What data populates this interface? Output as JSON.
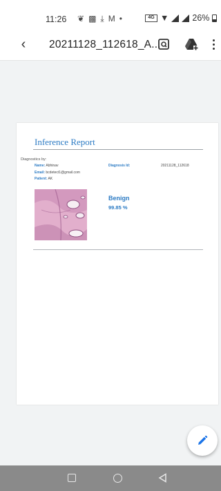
{
  "status_bar": {
    "time": "11:26",
    "icons_left": [
      "leaf-icon",
      "image-icon",
      "download-icon",
      "gmail-icon",
      "dot-icon"
    ],
    "battery_percent": "26%",
    "icons_right": [
      "data-saver-icon",
      "wifi-icon",
      "signal-icon",
      "signal-icon",
      "battery-icon"
    ]
  },
  "app_bar": {
    "title": "20211128_112618_A...",
    "back_icon": "back-arrow-icon",
    "open_icon": "open-in-app-icon",
    "drive_icon": "add-to-drive-icon",
    "more_icon": "more-vert-icon"
  },
  "report": {
    "title": "Inference Report",
    "diagnostics_by": "Diagnostics by:",
    "name_label": "Name:",
    "name_value": "Abhinav",
    "email_label": "Email:",
    "email_value": "bcdetect1@gmail.com",
    "patient_label": "Patient:",
    "patient_value": "AK",
    "diagnosis_id_label": "Diagnosis Id:",
    "diagnosis_id_value": "20211128_112618",
    "result": "Benign",
    "confidence": "99.85 %"
  },
  "fab": {
    "icon": "edit-pencil-icon"
  },
  "nav_bar": {
    "icons": [
      "recents-square-icon",
      "home-circle-icon",
      "back-triangle-icon"
    ]
  },
  "colors": {
    "accent": "#2c7bc4",
    "background": "#f1f3f4",
    "nav_bar": "#8a8a8a",
    "fab_icon": "#1a73e8"
  }
}
